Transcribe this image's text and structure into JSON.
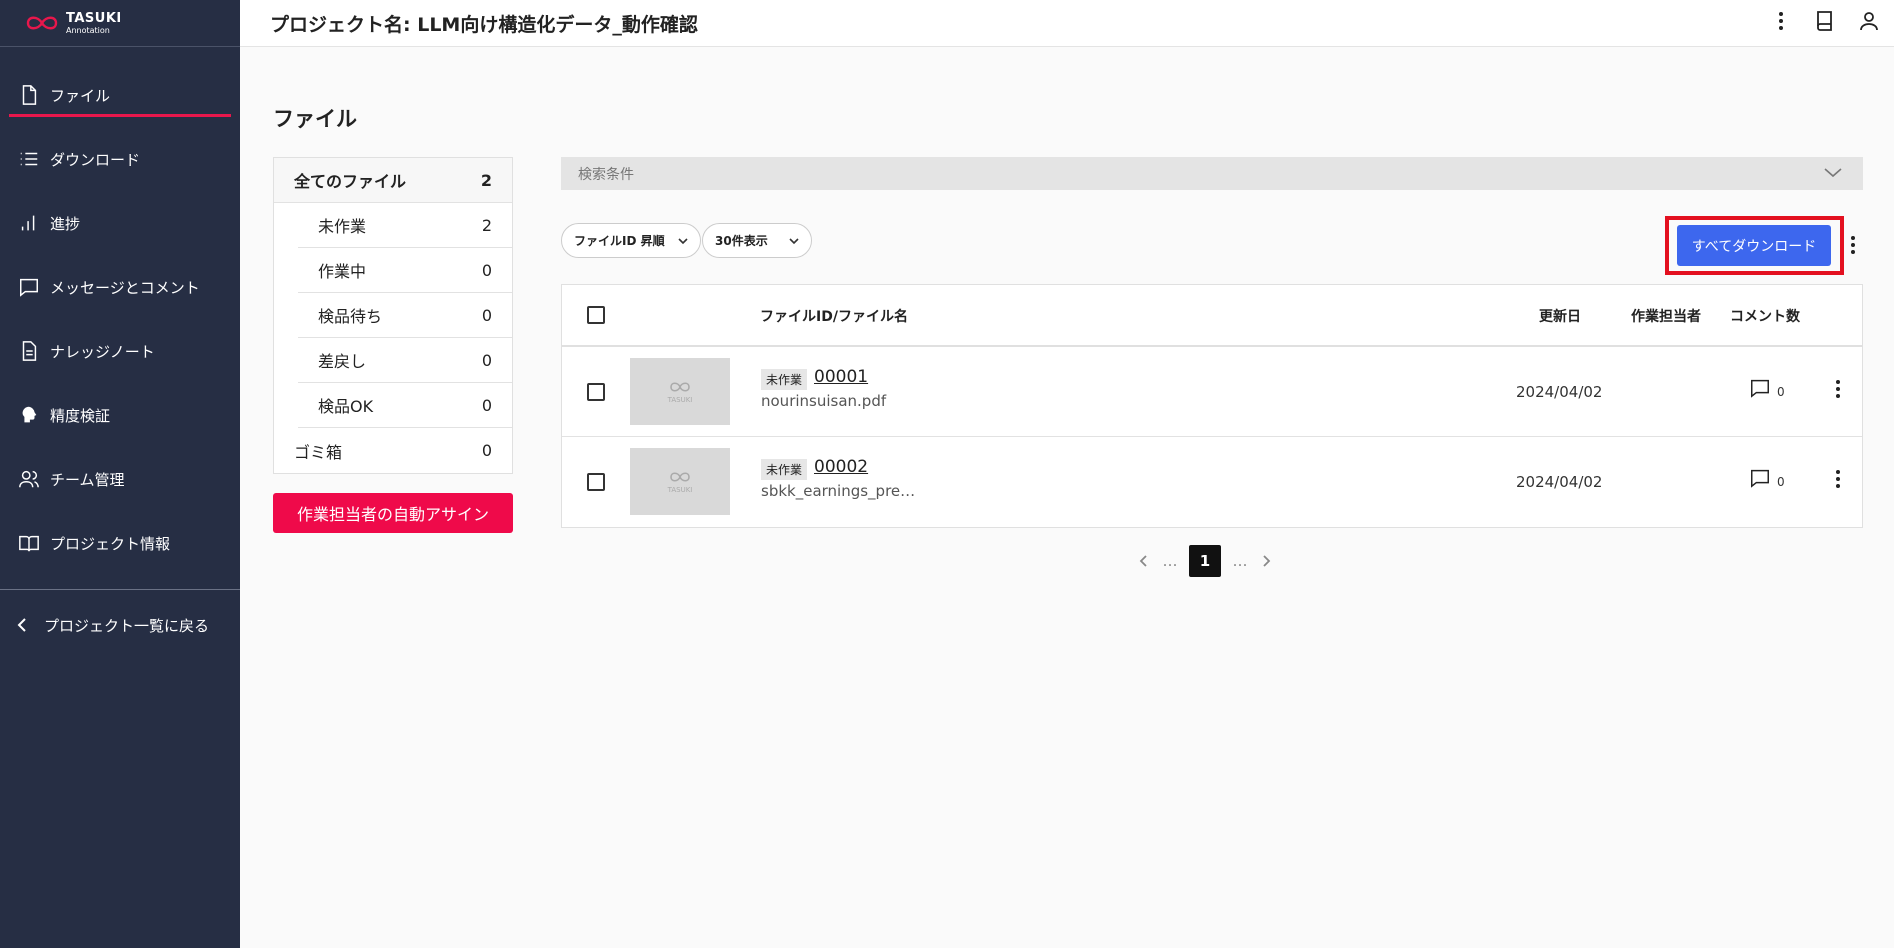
{
  "app": {
    "logo_title": "TASUKI",
    "logo_sub": "Annotation"
  },
  "header": {
    "project_title": "プロジェクト名: LLM向け構造化データ_動作確認",
    "icons": [
      "more-vert-icon",
      "book-icon",
      "user-icon"
    ]
  },
  "sidebar": {
    "items": [
      {
        "label": "ファイル",
        "icon": "file-icon",
        "active": true
      },
      {
        "label": "ダウンロード",
        "icon": "list-icon"
      },
      {
        "label": "進捗",
        "icon": "bar-chart-icon"
      },
      {
        "label": "メッセージとコメント",
        "icon": "message-icon"
      },
      {
        "label": "ナレッジノート",
        "icon": "note-icon"
      },
      {
        "label": "精度検証",
        "icon": "brain-icon"
      },
      {
        "label": "チーム管理",
        "icon": "team-icon"
      },
      {
        "label": "プロジェクト情報",
        "icon": "book-open-icon"
      }
    ],
    "back_label": "プロジェクト一覧に戻る"
  },
  "main": {
    "page_title": "ファイル",
    "status_filters": [
      {
        "label": "全てのファイル",
        "count": "2"
      },
      {
        "label": "未作業",
        "count": "2"
      },
      {
        "label": "作業中",
        "count": "0"
      },
      {
        "label": "検品待ち",
        "count": "0"
      },
      {
        "label": "差戻し",
        "count": "0"
      },
      {
        "label": "検品OK",
        "count": "0"
      },
      {
        "label": "ゴミ箱",
        "count": "0"
      }
    ],
    "assign_button": "作業担当者の自動アサイン",
    "search_label": "検索条件",
    "sort_select": "ファイルID 昇順",
    "count_select": "30件表示",
    "download_all_button": "すべてダウンロード",
    "table": {
      "headers": {
        "file": "ファイルID/ファイル名",
        "updated": "更新日",
        "assignee": "作業担当者",
        "comments": "コメント数"
      },
      "rows": [
        {
          "status": "未作業",
          "id": "00001",
          "name": "nourinsuisan.pdf",
          "updated": "2024/04/02",
          "assignee": "",
          "comments": "0"
        },
        {
          "status": "未作業",
          "id": "00002",
          "name": "sbkk_earnings_pre…",
          "updated": "2024/04/02",
          "assignee": "",
          "comments": "0"
        }
      ],
      "thumb_text": "TASUKI"
    },
    "pagination": {
      "current": "1",
      "ellipsis": "…"
    }
  },
  "colors": {
    "sidebar_bg": "#262e44",
    "accent_red": "#ef0a4a",
    "primary_blue": "#3d67ee",
    "highlight_box": "#e3101f"
  }
}
